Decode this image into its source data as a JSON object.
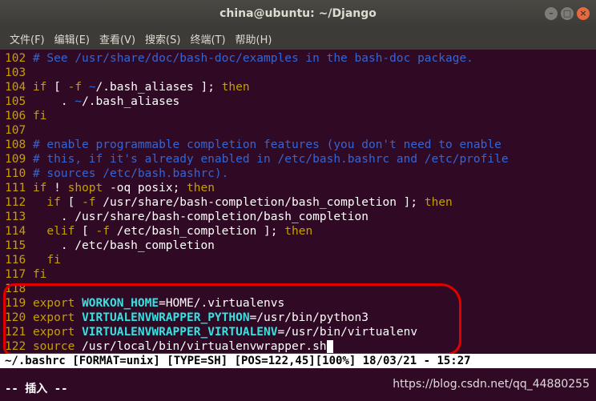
{
  "window": {
    "title": "china@ubuntu: ~/Django",
    "minimize_label": "–",
    "maximize_label": "□",
    "close_label": "×"
  },
  "menu": [
    "文件(F)",
    "编辑(E)",
    "查看(V)",
    "搜索(S)",
    "终端(T)",
    "帮助(H)"
  ],
  "lines": [
    {
      "n": "102",
      "segs": [
        {
          "t": "# See /usr/share/doc/bash-doc/examples in the bash-doc package.",
          "c": "comment"
        }
      ]
    },
    {
      "n": "103",
      "segs": []
    },
    {
      "n": "104",
      "segs": [
        {
          "t": "if",
          "c": "kw"
        },
        {
          "t": " [ ",
          "c": ""
        },
        {
          "t": "-f",
          "c": "kw"
        },
        {
          "t": " ",
          "c": ""
        },
        {
          "t": "~",
          "c": "tilde"
        },
        {
          "t": "/.bash_aliases ]; ",
          "c": ""
        },
        {
          "t": "then",
          "c": "kw"
        }
      ]
    },
    {
      "n": "105",
      "segs": [
        {
          "t": "    . ",
          "c": ""
        },
        {
          "t": "~",
          "c": "tilde"
        },
        {
          "t": "/.bash_aliases",
          "c": ""
        }
      ]
    },
    {
      "n": "106",
      "segs": [
        {
          "t": "fi",
          "c": "kw"
        }
      ]
    },
    {
      "n": "107",
      "segs": []
    },
    {
      "n": "108",
      "segs": [
        {
          "t": "# enable programmable completion features (you don't need to enable",
          "c": "comment"
        }
      ]
    },
    {
      "n": "109",
      "segs": [
        {
          "t": "# this, if it's already enabled in /etc/bash.bashrc and /etc/profile",
          "c": "comment"
        }
      ]
    },
    {
      "n": "110",
      "segs": [
        {
          "t": "# sources /etc/bash.bashrc).",
          "c": "comment"
        }
      ]
    },
    {
      "n": "111",
      "segs": [
        {
          "t": "if",
          "c": "kw"
        },
        {
          "t": " ! ",
          "c": ""
        },
        {
          "t": "shopt",
          "c": "kw"
        },
        {
          "t": " -oq posix; ",
          "c": ""
        },
        {
          "t": "then",
          "c": "kw"
        }
      ]
    },
    {
      "n": "112",
      "segs": [
        {
          "t": "  ",
          "c": ""
        },
        {
          "t": "if",
          "c": "kw"
        },
        {
          "t": " [ ",
          "c": ""
        },
        {
          "t": "-f",
          "c": "kw"
        },
        {
          "t": " /usr/share/bash-completion/bash_completion ]; ",
          "c": ""
        },
        {
          "t": "then",
          "c": "kw"
        }
      ]
    },
    {
      "n": "113",
      "segs": [
        {
          "t": "    . /usr/share/bash-completion/bash_completion",
          "c": ""
        }
      ]
    },
    {
      "n": "114",
      "segs": [
        {
          "t": "  ",
          "c": ""
        },
        {
          "t": "elif",
          "c": "kw"
        },
        {
          "t": " [ ",
          "c": ""
        },
        {
          "t": "-f",
          "c": "kw"
        },
        {
          "t": " /etc/bash_completion ]; ",
          "c": ""
        },
        {
          "t": "then",
          "c": "kw"
        }
      ]
    },
    {
      "n": "115",
      "segs": [
        {
          "t": "    . /etc/bash_completion",
          "c": ""
        }
      ]
    },
    {
      "n": "116",
      "segs": [
        {
          "t": "  ",
          "c": ""
        },
        {
          "t": "fi",
          "c": "kw"
        }
      ]
    },
    {
      "n": "117",
      "segs": [
        {
          "t": "fi",
          "c": "kw"
        }
      ]
    },
    {
      "n": "118",
      "segs": []
    },
    {
      "n": "119",
      "segs": [
        {
          "t": "export",
          "c": "kw"
        },
        {
          "t": " ",
          "c": ""
        },
        {
          "t": "WORKON_HOME",
          "c": "var"
        },
        {
          "t": "=HOME/.virtualenvs",
          "c": ""
        }
      ]
    },
    {
      "n": "120",
      "segs": [
        {
          "t": "export",
          "c": "kw"
        },
        {
          "t": " ",
          "c": ""
        },
        {
          "t": "VIRTUALENVWRAPPER_PYTHON",
          "c": "var"
        },
        {
          "t": "=/usr/bin/python3",
          "c": ""
        }
      ]
    },
    {
      "n": "121",
      "segs": [
        {
          "t": "export",
          "c": "kw"
        },
        {
          "t": " ",
          "c": ""
        },
        {
          "t": "VIRTUALENVWRAPPER_VIRTUALENV",
          "c": "var"
        },
        {
          "t": "=/usr/bin/virtualenv",
          "c": ""
        }
      ]
    },
    {
      "n": "122",
      "segs": [
        {
          "t": "source",
          "c": "kw"
        },
        {
          "t": " /usr/local/bin/virtualenvwrapper.sh",
          "c": ""
        },
        {
          "t": " ",
          "c": "cursor"
        }
      ]
    }
  ],
  "status": {
    "text": "~/.bashrc [FORMAT=unix] [TYPE=SH] [POS=122,45][100%] 18/03/21 - 15:27"
  },
  "mode": {
    "text": "-- 插入 --"
  },
  "watermark": "https://blog.csdn.net/qq_44880255",
  "colors": {
    "background": "#300a24",
    "line_number": "#c4a000",
    "comment": "#3465d4",
    "keyword": "#c4a000",
    "variable": "#34e2e2",
    "annotation": "#e00000"
  }
}
